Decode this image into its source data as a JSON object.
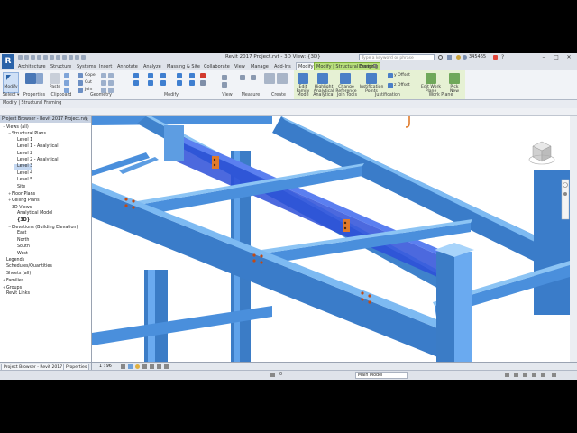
{
  "app": {
    "title": "Revit 2017   Project.rvt - 3D View: {3D}",
    "search_placeholder": "Type a keyword or phrase",
    "user": "345465",
    "logo": "R"
  },
  "tabs": [
    "Architecture",
    "Structure",
    "Systems",
    "Insert",
    "Annotate",
    "Analyze",
    "Massing & Site",
    "Collaborate",
    "View",
    "Manage",
    "Add-Ins",
    "Modify | Structural Framing",
    "Modify",
    "Design"
  ],
  "ribbon": {
    "select_label": "Modify",
    "panels": [
      "Select ▾",
      "Properties",
      "Clipboard",
      "Geometry",
      "Modify",
      "View",
      "Measure",
      "Create",
      "Mode",
      "Analytical",
      "Join Tools",
      "Justification",
      "Work Plane"
    ],
    "geometry_items": [
      "Cope",
      "Cut",
      "Join"
    ],
    "clipboard_paste": "Paste",
    "mode_btn": "Edit Family",
    "analytical_btn": "Highlight Analytical",
    "join_btn": "Change Reference",
    "justif_btn": "Justification Points",
    "yoffset": "y Offset",
    "zoffset": "z Offset",
    "workplane_btn": "Edit Work Plane",
    "picknew_btn": "Pick New"
  },
  "strip": {
    "context_label": "Modify | Structural Framing"
  },
  "project_browser": {
    "header": "Project Browser - Revit 2017 Project.rvt",
    "tree": [
      {
        "label": "Views (all)",
        "level": 0,
        "toggle": "−"
      },
      {
        "label": "Structural Plans",
        "level": 1,
        "toggle": "−"
      },
      {
        "label": "Level 1",
        "level": 2,
        "toggle": ""
      },
      {
        "label": "Level 1 - Analytical",
        "level": 2,
        "toggle": ""
      },
      {
        "label": "Level 2",
        "level": 2,
        "toggle": ""
      },
      {
        "label": "Level 2 - Analytical",
        "level": 2,
        "toggle": ""
      },
      {
        "label": "Level 3",
        "level": 2,
        "toggle": "",
        "selected": true
      },
      {
        "label": "Level 4",
        "level": 2,
        "toggle": ""
      },
      {
        "label": "Level 5",
        "level": 2,
        "toggle": ""
      },
      {
        "label": "Site",
        "level": 2,
        "toggle": ""
      },
      {
        "label": "Floor Plans",
        "level": 1,
        "toggle": "+"
      },
      {
        "label": "Ceiling Plans",
        "level": 1,
        "toggle": "+"
      },
      {
        "label": "3D Views",
        "level": 1,
        "toggle": "−"
      },
      {
        "label": "Analytical Model",
        "level": 2,
        "toggle": ""
      },
      {
        "label": "{3D}",
        "level": 2,
        "toggle": "",
        "bold": true
      },
      {
        "label": "Elevations (Building Elevation)",
        "level": 1,
        "toggle": "−"
      },
      {
        "label": "East",
        "level": 2,
        "toggle": ""
      },
      {
        "label": "North",
        "level": 2,
        "toggle": ""
      },
      {
        "label": "South",
        "level": 2,
        "toggle": ""
      },
      {
        "label": "West",
        "level": 2,
        "toggle": ""
      },
      {
        "label": "Legends",
        "level": 0,
        "toggle": ""
      },
      {
        "label": "Schedules/Quantities",
        "level": 0,
        "toggle": ""
      },
      {
        "label": "Sheets (all)",
        "level": 0,
        "toggle": ""
      },
      {
        "label": "Families",
        "level": 0,
        "toggle": "+"
      },
      {
        "label": "Groups",
        "level": 0,
        "toggle": "+"
      },
      {
        "label": "Revit Links",
        "level": 0,
        "toggle": ""
      }
    ],
    "tab_browser": "Project Browser - Revit 2017 Pr...",
    "tab_properties": "Properties"
  },
  "viewbar": {
    "scale": "1 : 96"
  },
  "status": {
    "model": "Main Model",
    "filter_count": "0"
  },
  "colors": {
    "steel": "#4a90dc",
    "steel_dark": "#2a5f9e",
    "selected": "#2d4fd8",
    "connection": "#e07a2a",
    "context_tab": "#b9e07c"
  }
}
